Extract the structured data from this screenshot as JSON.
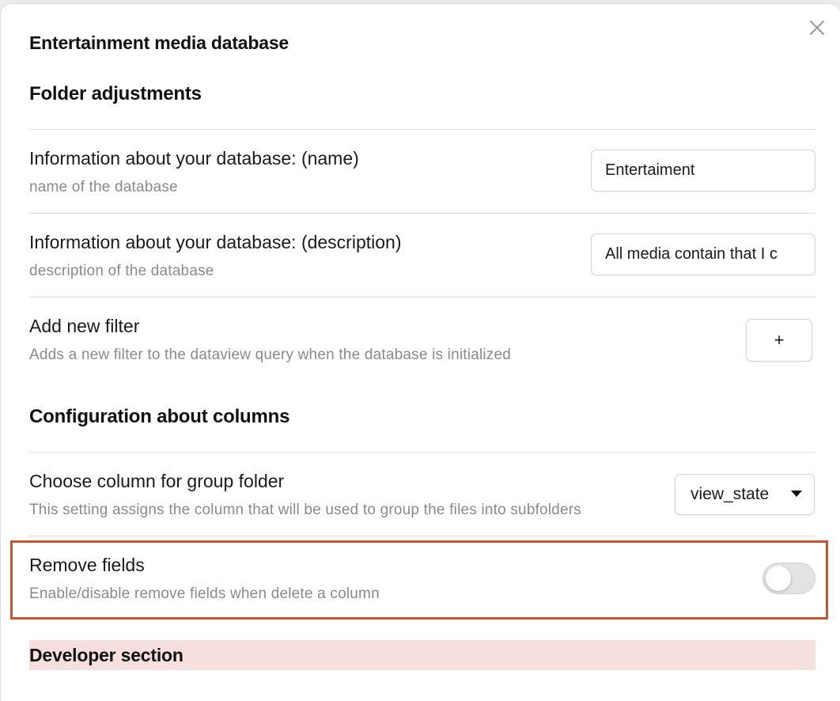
{
  "modal": {
    "title": "Entertainment media database"
  },
  "sections": {
    "folder": "Folder adjustments",
    "columns": "Configuration about columns",
    "developer": "Developer section"
  },
  "settings": {
    "name": {
      "label": "Information about your database: (name)",
      "description": "name of the database",
      "value": "Entertaiment"
    },
    "description": {
      "label": "Information about your database: (description)",
      "description": "description of the database",
      "value": "All media contain that I c"
    },
    "filter": {
      "label": "Add new filter",
      "description": "Adds a new filter to the dataview query when the database is initialized",
      "button_label": "+"
    },
    "group_folder": {
      "label": "Choose column for group folder",
      "description": "This setting assigns the column that will be used to group the files into subfolders",
      "selected": "view_state"
    },
    "remove_fields": {
      "label": "Remove fields",
      "description": "Enable/disable remove fields when delete a column",
      "enabled": false
    }
  },
  "icons": {
    "close": "close-icon",
    "dropdown": "caret-down-icon"
  },
  "colors": {
    "highlight_border": "#c8562d",
    "developer_section_bg": "#f6e0dd",
    "toggle_off": "#e3e3e3"
  }
}
